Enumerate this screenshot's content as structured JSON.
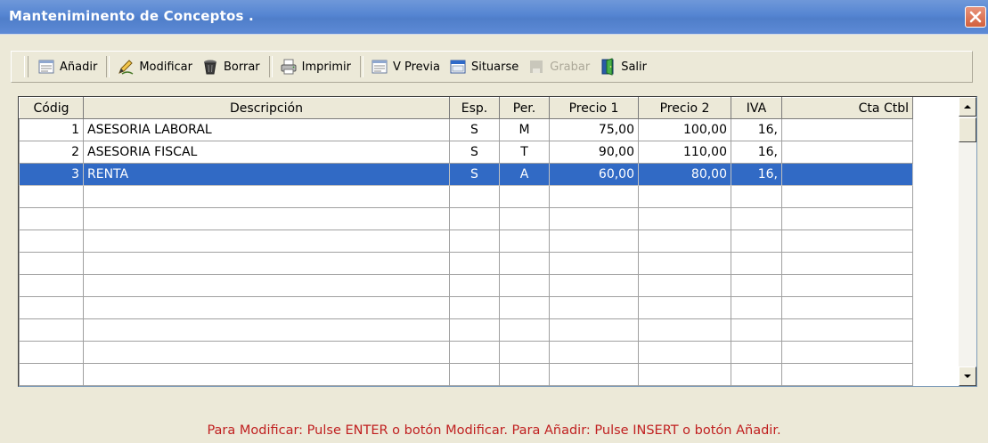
{
  "window": {
    "title": "Manteniminento de Conceptos ."
  },
  "toolbar": {
    "add": "Añadir",
    "modify": "Modificar",
    "delete": "Borrar",
    "print": "Imprimir",
    "preview": "V Previa",
    "locate": "Situarse",
    "save": "Grabar",
    "exit": "Salir"
  },
  "grid": {
    "headers": [
      "Códig",
      "Descripción",
      "Esp.",
      "Per.",
      "Precio 1",
      "Precio 2",
      "IVA",
      "Cta Ctbl"
    ],
    "rows": [
      {
        "code": "1",
        "description": "ASESORIA LABORAL",
        "esp": "S",
        "per": "M",
        "price1": "75,00",
        "price2": "100,00",
        "iva": "16,",
        "account": ""
      },
      {
        "code": "2",
        "description": "ASESORIA FISCAL",
        "esp": "S",
        "per": "T",
        "price1": "90,00",
        "price2": "110,00",
        "iva": "16,",
        "account": ""
      },
      {
        "code": "3",
        "description": "RENTA",
        "esp": "S",
        "per": "A",
        "price1": "60,00",
        "price2": "80,00",
        "iva": "16,",
        "account": "",
        "selected": true
      }
    ]
  },
  "status_message": "Para Modificar: Pulse ENTER o botón Modificar. Para Añadir: Pulse INSERT o botón Añadir."
}
